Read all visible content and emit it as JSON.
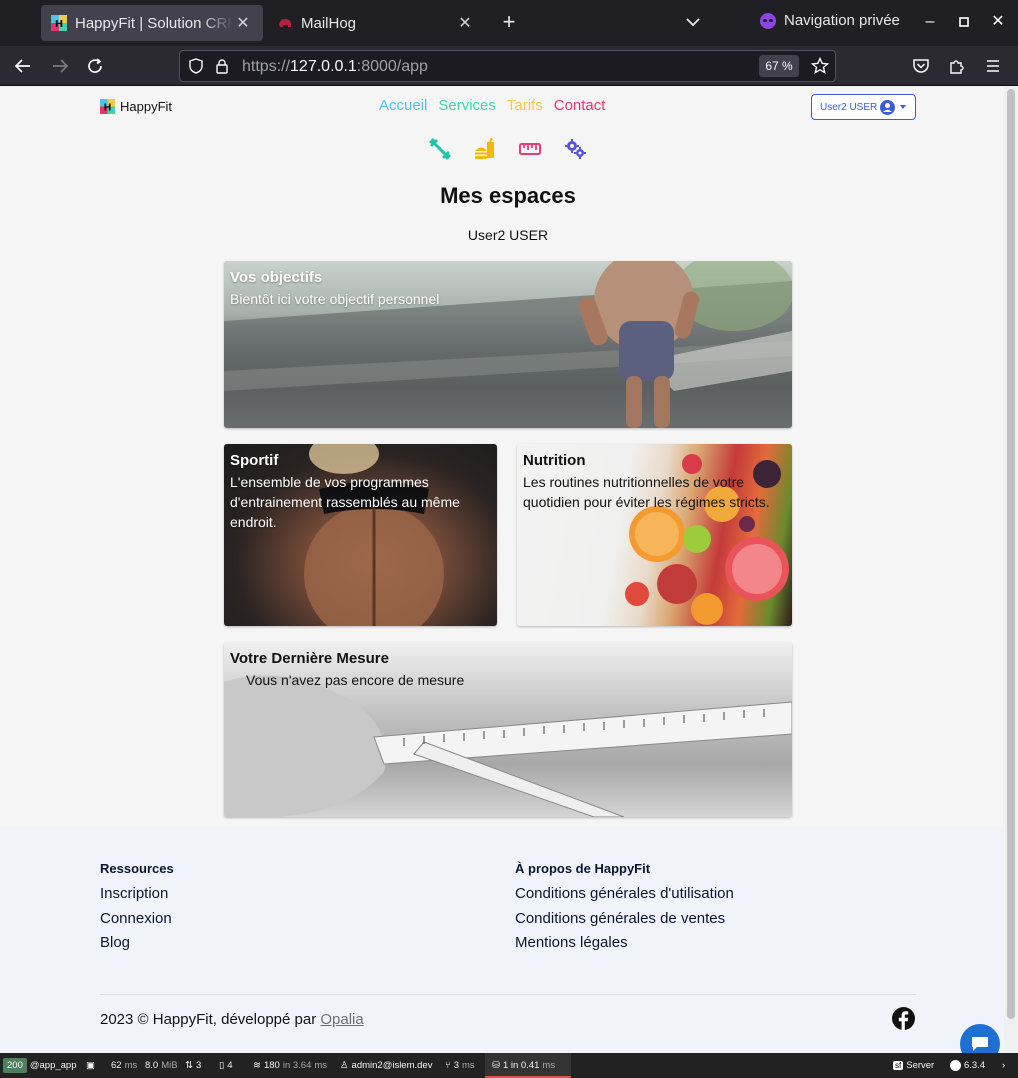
{
  "browser": {
    "tabs": [
      {
        "title": "HappyFit | Solution CRM",
        "active": true
      },
      {
        "title": "MailHog",
        "active": false
      }
    ],
    "new_tab": "+",
    "private_label": "Navigation privée",
    "url_prefix": "https://",
    "url_host": "127.0.0.1",
    "url_suffix": ":8000/app",
    "zoom": "67 %"
  },
  "header": {
    "brand": "HappyFit",
    "nav": [
      {
        "label": "Accueil",
        "color": "#4fc3e6"
      },
      {
        "label": "Services",
        "color": "#3ed6b0"
      },
      {
        "label": "Tarifs",
        "color": "#f2c94c"
      },
      {
        "label": "Contact",
        "color": "#e8336d"
      }
    ],
    "user_button": "User2 USER",
    "icons": [
      {
        "name": "dumbbell-icon",
        "color": "#1bc5a9"
      },
      {
        "name": "burger-drink-icon",
        "color": "#f5b800"
      },
      {
        "name": "ruler-icon",
        "color": "#e63c78"
      },
      {
        "name": "gears-icon",
        "color": "#5a52d6"
      }
    ]
  },
  "main": {
    "title": "Mes espaces",
    "user": "User2 USER",
    "cards": {
      "objectifs": {
        "title": "Vos objectifs",
        "subtitle": "Bientôt ici votre objectif personnel"
      },
      "sportif": {
        "title": "Sportif",
        "subtitle": "L'ensemble de vos programmes d'entrainement rassemblés au même endroit."
      },
      "nutrition": {
        "title": "Nutrition",
        "subtitle": "Les routines nutritionnelles de votre quotidien pour éviter les régimes stricts."
      },
      "mesure": {
        "title": "Votre Dernière Mesure",
        "subtitle": "Vous n'avez pas encore de mesure"
      }
    }
  },
  "footer": {
    "ressources": {
      "heading": "Ressources",
      "links": [
        "Inscription",
        "Connexion",
        "Blog"
      ]
    },
    "apropos": {
      "heading": "À propos de HappyFit",
      "links": [
        "Conditions générales d'utilisation",
        "Conditions générales de ventes",
        "Mentions légales"
      ]
    },
    "copyright": "2023 © HappyFit, développé par",
    "developer": "Opalia"
  },
  "symfony_toolbar": {
    "status": "200",
    "route": "@app_app",
    "time": "62",
    "time_unit": "ms",
    "memory": "8.0",
    "memory_unit": "MiB",
    "forms": "3",
    "twig": "4",
    "cache": "180",
    "cache_detail": "in 3.64",
    "cache_unit": "ms",
    "user": "admin2@islem.dev",
    "events": "3",
    "events_unit": "ms",
    "db": "1 in 0.41",
    "db_unit": "ms",
    "server": "Server",
    "version": "6.3.4"
  }
}
